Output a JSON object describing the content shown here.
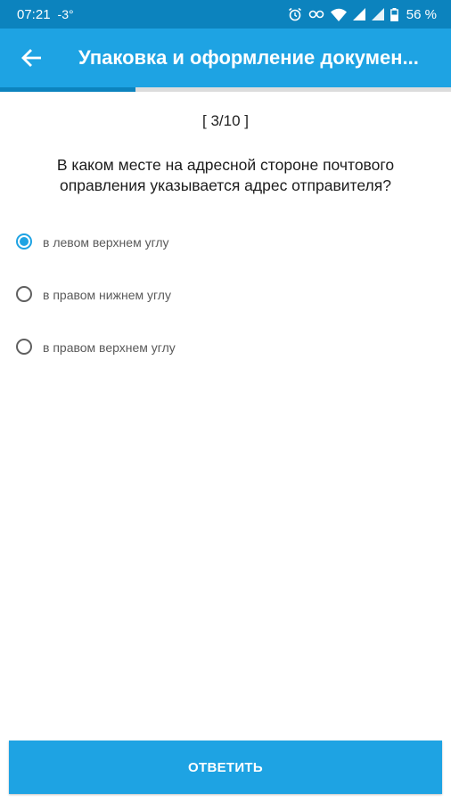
{
  "status_bar": {
    "time": "07:21",
    "temperature": "-3°",
    "battery_percent": "56 %",
    "icons": [
      "alarm-icon",
      "link-icon",
      "wifi-icon",
      "signal-icon",
      "signal-icon",
      "battery-icon"
    ]
  },
  "app_bar": {
    "title": "Упаковка и оформление докумен...",
    "back_icon": "arrow-left-icon"
  },
  "progress": {
    "current": 3,
    "total": 10,
    "fraction": 0.3
  },
  "quiz": {
    "counter": "[ 3/10 ]",
    "question": "В каком месте на адресной стороне почтового оправления указывается адрес отправителя?",
    "options": [
      {
        "label": "в левом верхнем углу",
        "selected": true
      },
      {
        "label": "в правом нижнем углу",
        "selected": false
      },
      {
        "label": "в правом верхнем углу",
        "selected": false
      }
    ]
  },
  "answer_button": {
    "label": "ОТВЕТИТЬ"
  },
  "colors": {
    "status_bar": "#0c83be",
    "app_bar": "#1ea3e3",
    "accent": "#1ea3e3",
    "progress_fill": "#0c83be",
    "progress_track": "#dcdcdc"
  }
}
